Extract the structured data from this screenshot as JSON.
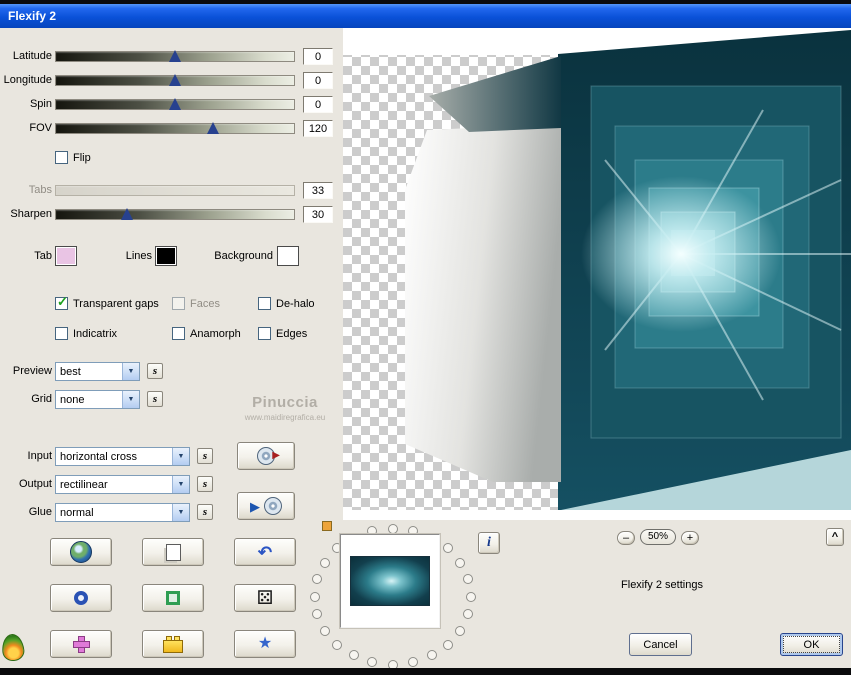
{
  "window": {
    "title": "Flexify 2"
  },
  "sliders": {
    "latitude": {
      "label": "Latitude",
      "value": "0"
    },
    "longitude": {
      "label": "Longitude",
      "value": "0"
    },
    "spin": {
      "label": "Spin",
      "value": "0"
    },
    "fov": {
      "label": "FOV",
      "value": "120"
    },
    "tabs": {
      "label": "Tabs",
      "value": "33"
    },
    "sharpen": {
      "label": "Sharpen",
      "value": "30"
    }
  },
  "checkboxes": {
    "flip": "Flip",
    "transparent_gaps": "Transparent gaps",
    "faces": "Faces",
    "dehalo": "De-halo",
    "indicatrix": "Indicatrix",
    "anamorph": "Anamorph",
    "edges": "Edges"
  },
  "swatches": {
    "tab_label": "Tab",
    "tab_color": "#e9c4e4",
    "lines_label": "Lines",
    "lines_color": "#000000",
    "background_label": "Background",
    "background_color": "#ffffff"
  },
  "selects": {
    "preview": {
      "label": "Preview",
      "value": "best"
    },
    "grid": {
      "label": "Grid",
      "value": "none"
    },
    "input": {
      "label": "Input",
      "value": "horizontal cross"
    },
    "output": {
      "label": "Output",
      "value": "rectilinear"
    },
    "glue": {
      "label": "Glue",
      "value": "normal"
    }
  },
  "watermark": {
    "line1": "Pinuccia",
    "line2": "www.maidiregrafica.eu"
  },
  "zoom": {
    "minus": "–",
    "level": "50%",
    "plus": "+"
  },
  "footer": {
    "settings_label": "Flexify 2 settings",
    "cancel": "Cancel",
    "ok": "OK",
    "caret": "^",
    "info": "i"
  },
  "icons": {
    "dropdown_arrow": "▼",
    "s_button": "s",
    "undo": "↶",
    "dice": "⚄",
    "gem": "★",
    "play": "▶",
    "check": "✓"
  }
}
